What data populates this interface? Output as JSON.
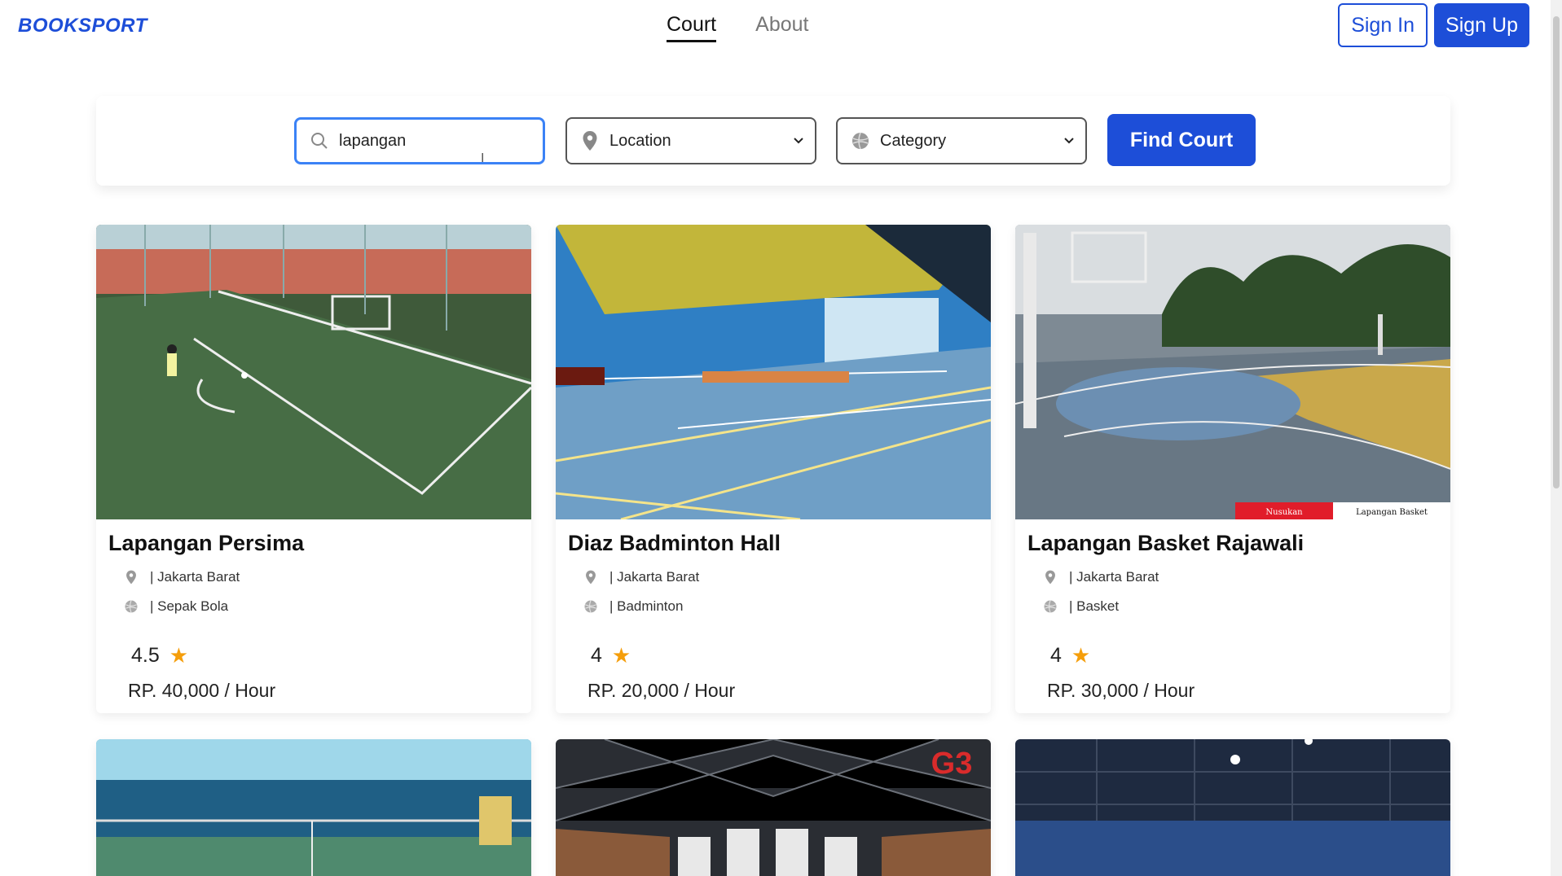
{
  "brand": "BOOKSPORT",
  "nav": {
    "court": "Court",
    "about": "About"
  },
  "auth": {
    "sign_in": "Sign In",
    "sign_up": "Sign Up"
  },
  "search": {
    "query": "lapangan",
    "location_label": "Location",
    "category_label": "Category",
    "button": "Find Court"
  },
  "colors": {
    "primary": "#1d4ed8",
    "star": "#f59e0b"
  },
  "courts": [
    {
      "name": "Lapangan Persima",
      "location": "| Jakarta Barat",
      "category": "| Sepak Bola",
      "rating": "4.5",
      "price": "RP. 40,000 / Hour",
      "icons": [
        "map-pin-icon",
        "ball-icon",
        "star-icon"
      ]
    },
    {
      "name": "Diaz Badminton Hall",
      "location": "| Jakarta Barat",
      "category": "| Badminton",
      "rating": "4",
      "price": "RP. 20,000 / Hour",
      "icons": [
        "map-pin-icon",
        "ball-icon",
        "star-icon"
      ]
    },
    {
      "name": "Lapangan Basket Rajawali",
      "location": "| Jakarta Barat",
      "category": "| Basket",
      "rating": "4",
      "price": "RP. 30,000 / Hour",
      "image_caption_left": "Nusukan",
      "image_caption_right": "Lapangan Basket",
      "icons": [
        "map-pin-icon",
        "ball-icon",
        "star-icon"
      ]
    }
  ],
  "row2_badge": "G3"
}
